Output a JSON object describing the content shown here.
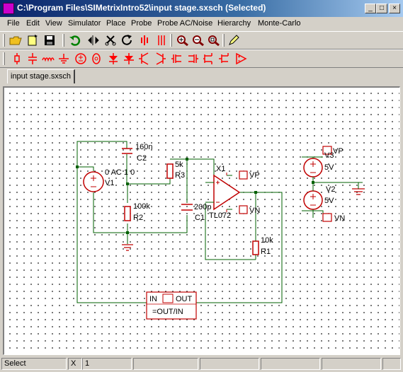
{
  "window": {
    "title": "C:\\Program Files\\SIMetrixIntro52\\input stage.sxsch (Selected)",
    "minimize": "_",
    "maximize": "□",
    "close": "×"
  },
  "menu": [
    "File",
    "Edit",
    "View",
    "Simulator",
    "Place",
    "Probe",
    "Probe AC/Noise",
    "Hierarchy",
    "Monte-Carlo"
  ],
  "toolbar1": [
    "open-icon",
    "new-icon",
    "save-icon",
    "undo-icon",
    "mirror-icon",
    "cut-icon",
    "rotate-icon",
    "probe-voltage-icon",
    "probe-differential-icon",
    "zoom-in-icon",
    "zoom-out-icon",
    "zoom-fit-icon",
    "pencil-icon"
  ],
  "toolbar2": [
    "resistor-icon",
    "capacitor-icon",
    "inductor-icon",
    "ground-icon",
    "voltage-source-icon",
    "current-source-icon",
    "diode-icon",
    "zener-icon",
    "npn-icon",
    "pnp-icon",
    "nmos-icon",
    "pmos-icon",
    "opamp-icon"
  ],
  "tab": {
    "label": "input stage.sxsch"
  },
  "schematic": {
    "C2": {
      "value": "160n",
      "ref": "C2"
    },
    "V1": {
      "value": "0 AC 1 0",
      "ref": "V1"
    },
    "R3": {
      "value": "5k",
      "ref": "R3"
    },
    "R2": {
      "value": "100k",
      "ref": "R2"
    },
    "C1": {
      "value": "200p",
      "ref": "C1"
    },
    "X1": {
      "ref": "X1",
      "model": "TL072",
      "vp": "VP",
      "vn": "VN"
    },
    "R1": {
      "value": "10k",
      "ref": "R1"
    },
    "V3": {
      "ref": "V3",
      "value": "5V",
      "net": "VP"
    },
    "V2": {
      "ref": "V2",
      "value": "5V",
      "net": "VN"
    },
    "probe": {
      "in": "IN",
      "out": "OUT",
      "expr": "=OUT/IN"
    }
  },
  "status": {
    "mode": "Select",
    "axis": "X",
    "value": "1"
  }
}
